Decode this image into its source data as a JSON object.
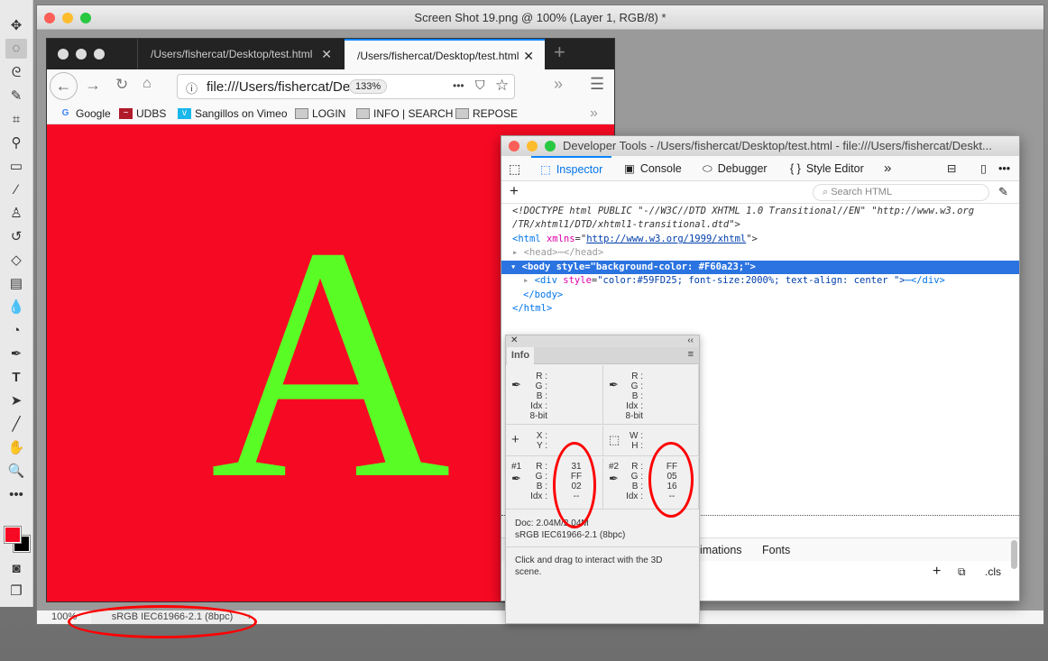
{
  "photoshop": {
    "title": "Screen Shot 19.png @ 100% (Layer 1, RGB/8) *",
    "status_zoom": "100%",
    "status_profile": "sRGB IEC61966-2.1 (8bpc)",
    "status_arrow": "›",
    "tools": [
      "move",
      "elliptical-marquee",
      "lasso",
      "quick-selection",
      "crop",
      "eyedropper",
      "healing-brush",
      "brush",
      "clone-stamp",
      "history-brush",
      "eraser",
      "gradient",
      "blur",
      "dodge",
      "pen",
      "type",
      "path-selection",
      "line",
      "hand",
      "zoom",
      "more"
    ],
    "foreground_color": "#F60A23",
    "background_color": "#000000"
  },
  "firefox": {
    "tabs": [
      {
        "label": "/Users/fishercat/Desktop/test.html",
        "active": false
      },
      {
        "label": "/Users/fishercat/Desktop/test.html",
        "active": true
      }
    ],
    "new_tab": "+",
    "url": "file:///Users/fishercat/Desk",
    "zoom": "133%",
    "more": "•••",
    "bookmarks": [
      "Google",
      "UDBS",
      "Sangillos on Vimeo",
      "LOGIN",
      "INFO | SEARCH",
      "REPOSE"
    ],
    "overflow": "»",
    "page_letter": "A",
    "page_bg": "#F60A23",
    "letter_color": "#59FD25"
  },
  "devtools": {
    "title": "Developer Tools - /Users/fishercat/Desktop/test.html - file:///Users/fishercat/Deskt...",
    "tabs": [
      "Inspector",
      "Console",
      "Debugger",
      "Style Editor"
    ],
    "overflow": "»",
    "search_placeholder": "Search HTML",
    "markup": {
      "doctype1": "<!DOCTYPE html PUBLIC \"-//W3C//DTD XHTML 1.0 Transitional//EN\" \"http://www.w3.org",
      "doctype2": "/TR/xhtml1/DTD/xhtml1-transitional.dtd\">",
      "html_open": "<html",
      "xmlns_attr": "xmlns",
      "xmlns_val": "http://www.w3.org/1999/xhtml",
      "head": "<head>⋯</head>",
      "body": "<body style=\"background-color: #F60a23;\">",
      "div_open": "<div",
      "div_attr": "style",
      "div_val": "\"color:#59FD25; font-size:2000%; text-align: center \">",
      "div_close": "⋯</div>",
      "body_close": "</body>",
      "html_close": "</html>"
    },
    "bottom_tabs": [
      "imations",
      "Fonts"
    ],
    "cls": ".cls"
  },
  "info_panel": {
    "tab": "Info",
    "rgb_labels": [
      "R :",
      "G :",
      "B :",
      "Idx :"
    ],
    "bit_label": "8-bit",
    "xy_labels": [
      "X :",
      "Y :"
    ],
    "wh_labels": [
      "W :",
      "H :"
    ],
    "sample1": {
      "id": "#1",
      "values": [
        "31",
        "FF",
        "02",
        "--"
      ]
    },
    "sample2": {
      "id": "#2",
      "values": [
        "FF",
        "05",
        "16",
        "--"
      ]
    },
    "doc": "Doc: 2.04M/2.04M",
    "profile": "sRGB IEC61966-2.1 (8bpc)",
    "hint": "Click and drag to interact with the 3D scene."
  },
  "annotation_color": "#FF0000"
}
